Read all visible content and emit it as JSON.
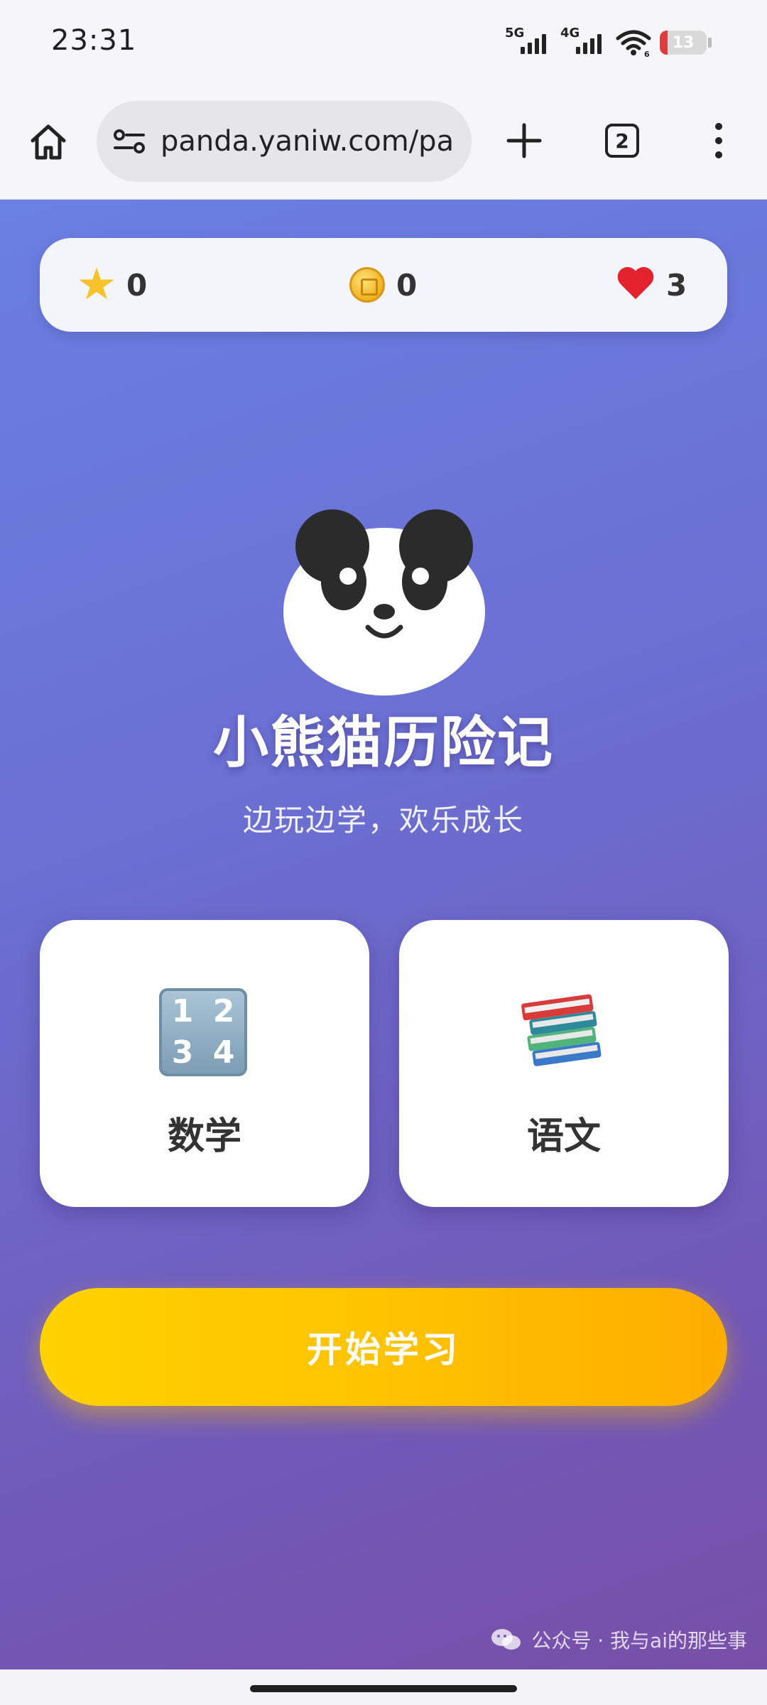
{
  "status_bar": {
    "time": "23:31",
    "network_1": "5G",
    "network_2": "4G",
    "wifi_badge": "6",
    "battery": "13",
    "battery_color": "#e33b3b"
  },
  "browser": {
    "url": "panda.yaniw.com/pa",
    "tab_count": "2",
    "icons": [
      "home-icon",
      "site-settings-icon",
      "plus-icon",
      "tabs-icon",
      "more-vert-icon"
    ]
  },
  "stats": {
    "stars": "0",
    "coins": "0",
    "lives": "3",
    "icons": [
      "star-icon",
      "coin-icon",
      "heart-icon"
    ]
  },
  "hero": {
    "title": "小熊猫历险记",
    "subtitle": "边玩边学，欢乐成长"
  },
  "subjects": [
    {
      "label": "数学",
      "icon": "numbers-1234-icon",
      "digits": [
        "1",
        "2",
        "3",
        "4"
      ]
    },
    {
      "label": "语文",
      "icon": "books-icon"
    }
  ],
  "start_button": {
    "label": "开始学习"
  },
  "watermark": {
    "text": "公众号 · 我与ai的那些事"
  },
  "colors": {
    "background_gradient": [
      "#6a80e2",
      "#784fa8"
    ],
    "button_gradient": [
      "#ffd200",
      "#ffad00"
    ],
    "card": "#ffffff"
  }
}
